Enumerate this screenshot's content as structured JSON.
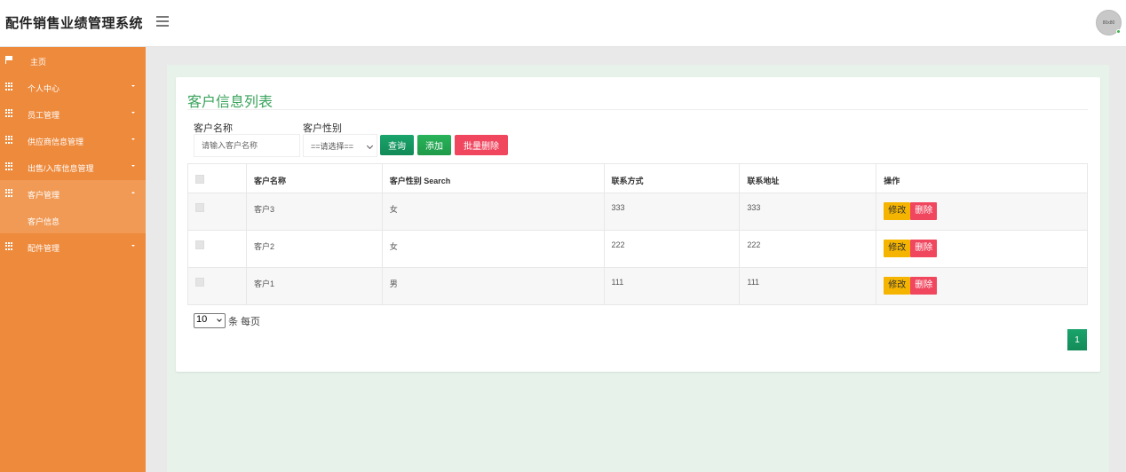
{
  "header": {
    "app_title": "配件销售业绩管理系统",
    "avatar_text": "80x80"
  },
  "sidebar": {
    "items": [
      {
        "label": "主页",
        "icon": "flag-icon"
      },
      {
        "label": "个人中心",
        "icon": "grid-icon"
      },
      {
        "label": "员工管理",
        "icon": "grid-icon"
      },
      {
        "label": "供应商信息管理",
        "icon": "grid-icon"
      },
      {
        "label": "出售/入库信息管理",
        "icon": "grid-icon"
      },
      {
        "label": "客户管理",
        "icon": "grid-icon",
        "expanded": true
      },
      {
        "label": "配件管理",
        "icon": "grid-icon"
      }
    ],
    "sub_items": [
      {
        "label": "客户信息"
      }
    ]
  },
  "panel": {
    "title": "客户信息列表",
    "filters": {
      "name_label": "客户名称",
      "name_placeholder": "请输入客户名称",
      "gender_label": "客户性别",
      "gender_selected": "==请选择=="
    },
    "buttons": {
      "search": "查询",
      "add": "添加",
      "batch_delete": "批量删除"
    }
  },
  "table": {
    "headers": [
      "客户名称",
      "客户性别 Search",
      "联系方式",
      "联系地址",
      "操作"
    ],
    "rows": [
      {
        "name": "客户3",
        "gender": "女",
        "phone": "333",
        "address": "333"
      },
      {
        "name": "客户2",
        "gender": "女",
        "phone": "222",
        "address": "222"
      },
      {
        "name": "客户1",
        "gender": "男",
        "phone": "111",
        "address": "111"
      }
    ],
    "row_actions": {
      "edit": "修改",
      "delete": "删除"
    }
  },
  "pagination": {
    "page_size": "10",
    "page_size_suffix": "条 每页",
    "current_page": "1"
  },
  "colors": {
    "sidebar": "#ee8a3c",
    "accent_green": "#1aa46c",
    "danger": "#f0465e",
    "warning": "#f5b400"
  }
}
